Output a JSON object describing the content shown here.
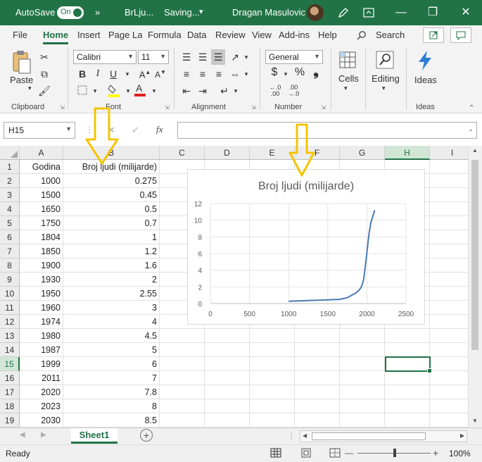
{
  "titlebar": {
    "autosave_label": "AutoSave",
    "toggle_label": "On",
    "more": "»",
    "file_name": "BrLju...",
    "saving": "Saving...",
    "chevron": "▾",
    "user_name": "Dragan Masulovic",
    "minimize": "—",
    "restore": "❐",
    "close": "✕"
  },
  "tabs": [
    "File",
    "Home",
    "Insert",
    "Page La",
    "Formula",
    "Data",
    "Review",
    "View",
    "Add-ins",
    "Help"
  ],
  "search_label": "Search",
  "ribbon": {
    "paste": "Paste",
    "clipboard": "Clipboard",
    "font_name": "Calibri",
    "font_size": "11",
    "font": "Font",
    "bold": "B",
    "italic": "I",
    "underline": "U",
    "alignment": "Alignment",
    "number_format": "General",
    "currency": "$",
    "percent": "%",
    "comma": "❟",
    "number": "Number",
    "cells": "Cells",
    "editing": "Editing",
    "ideas": "Ideas",
    "ideas_group": "Ideas"
  },
  "formula_bar": {
    "name_box": "H15",
    "fx": "fx",
    "cancel": "✕",
    "enter": "✓",
    "value": ""
  },
  "columns": [
    "A",
    "B",
    "C",
    "D",
    "E",
    "F",
    "G",
    "H",
    "I"
  ],
  "selected_column": "H",
  "selected_row": "15",
  "rows": [
    {
      "n": "1",
      "a": "Godina",
      "b": "Broj ljudi (milijarde)"
    },
    {
      "n": "2",
      "a": "1000",
      "b": "0.275"
    },
    {
      "n": "3",
      "a": "1500",
      "b": "0.45"
    },
    {
      "n": "4",
      "a": "1650",
      "b": "0.5"
    },
    {
      "n": "5",
      "a": "1750",
      "b": "0.7"
    },
    {
      "n": "6",
      "a": "1804",
      "b": "1"
    },
    {
      "n": "7",
      "a": "1850",
      "b": "1.2"
    },
    {
      "n": "8",
      "a": "1900",
      "b": "1.6"
    },
    {
      "n": "9",
      "a": "1930",
      "b": "2"
    },
    {
      "n": "10",
      "a": "1950",
      "b": "2.55"
    },
    {
      "n": "11",
      "a": "1960",
      "b": "3"
    },
    {
      "n": "12",
      "a": "1974",
      "b": "4"
    },
    {
      "n": "13",
      "a": "1980",
      "b": "4.5"
    },
    {
      "n": "14",
      "a": "1987",
      "b": "5"
    },
    {
      "n": "15",
      "a": "1999",
      "b": "6"
    },
    {
      "n": "16",
      "a": "2011",
      "b": "7"
    },
    {
      "n": "17",
      "a": "2020",
      "b": "7.8"
    },
    {
      "n": "18",
      "a": "2023",
      "b": "8"
    },
    {
      "n": "19",
      "a": "2030",
      "b": "8.5"
    }
  ],
  "sheet_tab": "Sheet1",
  "status": {
    "ready": "Ready",
    "zoom": "100%",
    "minus": "—",
    "plus": "+"
  },
  "colors": {
    "accent": "#217346",
    "arrow": "#f5c400",
    "series": "#4a78b5"
  },
  "chart_data": {
    "type": "line",
    "title": "Broj ljudi (milijarde)",
    "xlabel": "",
    "ylabel": "",
    "x_ticks": [
      "0",
      "500",
      "1000",
      "1500",
      "2000",
      "2500"
    ],
    "y_ticks": [
      "0",
      "2",
      "4",
      "6",
      "8",
      "10",
      "12"
    ],
    "xlim": [
      0,
      2500
    ],
    "ylim": [
      0,
      12
    ],
    "grid": true,
    "legend": "none",
    "series": [
      {
        "x": [
          1000,
          1500,
          1650,
          1750,
          1804,
          1850,
          1900,
          1930,
          1950,
          1960,
          1974,
          1980,
          1987,
          1999,
          2011,
          2020,
          2023,
          2030,
          2050,
          2100
        ],
        "y": [
          0.275,
          0.45,
          0.5,
          0.7,
          1,
          1.2,
          1.6,
          2,
          2.55,
          3,
          4,
          4.5,
          5,
          6,
          7,
          7.8,
          8,
          8.5,
          9.7,
          11.2
        ]
      }
    ]
  }
}
